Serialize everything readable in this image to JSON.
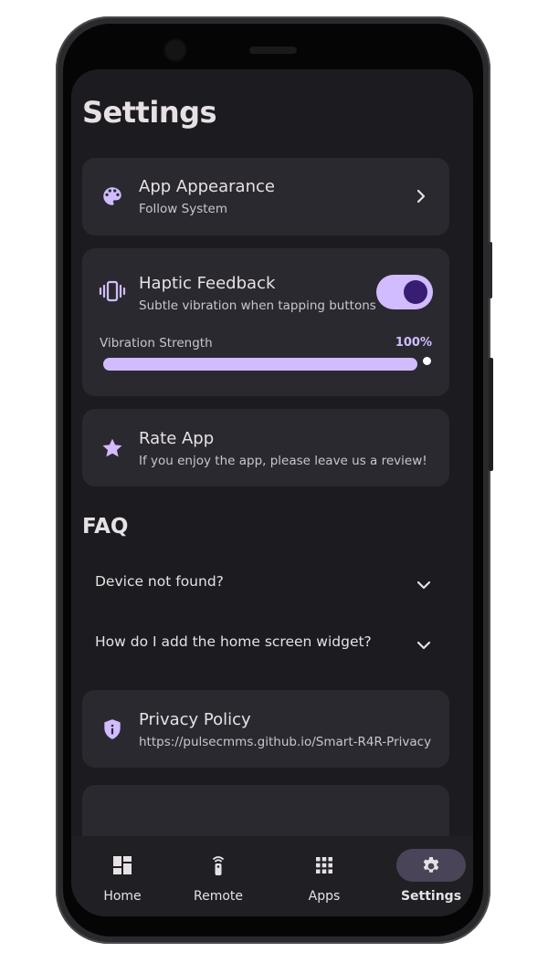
{
  "page": {
    "title": "Settings"
  },
  "cards": {
    "appearance": {
      "title": "App Appearance",
      "subtitle": "Follow System"
    },
    "haptic": {
      "title": "Haptic Feedback",
      "subtitle": "Subtle vibration when tapping buttons",
      "enabled": true,
      "slider_label": "Vibration Strength",
      "slider_value": "100%",
      "slider_fraction": 1.0
    },
    "rate": {
      "title": "Rate App",
      "subtitle": "If you enjoy the app, please leave us a review!"
    },
    "privacy": {
      "title": "Privacy Policy",
      "subtitle": "https://pulsecmms.github.io/Smart-R4R-Privacy"
    }
  },
  "faq": {
    "title": "FAQ",
    "items": [
      {
        "question": "Device not found?"
      },
      {
        "question": "How do I add the home screen widget?"
      }
    ]
  },
  "bottom_nav": {
    "items": [
      {
        "label": "Home",
        "icon": "dashboard-icon"
      },
      {
        "label": "Remote",
        "icon": "remote-icon"
      },
      {
        "label": "Apps",
        "icon": "apps-grid-icon"
      },
      {
        "label": "Settings",
        "icon": "gear-icon",
        "active": true
      }
    ]
  },
  "colors": {
    "accent": "#d0bcff",
    "background": "#1c1b1f",
    "card": "#2b2930",
    "nav_active": "#4a4458"
  }
}
